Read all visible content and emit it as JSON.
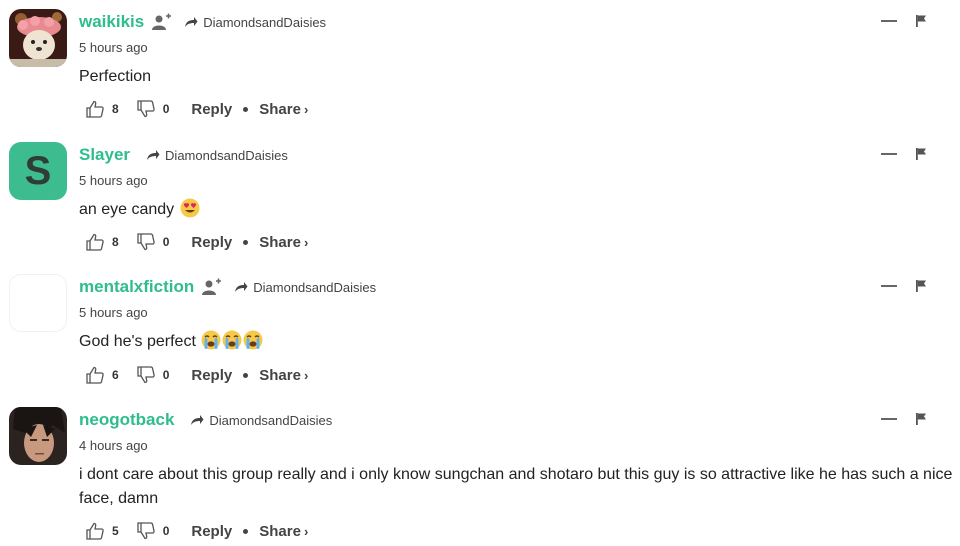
{
  "comments": [
    {
      "username": "waikikis",
      "reply_to": "DiamondsandDaisies",
      "time": "5 hours ago",
      "text": "Perfection",
      "likes": "8",
      "dislikes": "0",
      "reply_label": "Reply",
      "share_label": "Share",
      "share_chevron": "›"
    },
    {
      "username": "Slayer",
      "avatar_letter": "S",
      "reply_to": "DiamondsandDaisies",
      "time": "5 hours ago",
      "text": "an eye candy",
      "likes": "8",
      "dislikes": "0",
      "reply_label": "Reply",
      "share_label": "Share",
      "share_chevron": "›"
    },
    {
      "username": "mentalxfiction",
      "reply_to": "DiamondsandDaisies",
      "time": "5 hours ago",
      "text": "God he's perfect",
      "likes": "6",
      "dislikes": "0",
      "reply_label": "Reply",
      "share_label": "Share",
      "share_chevron": "›"
    },
    {
      "username": "neogotback",
      "reply_to": "DiamondsandDaisies",
      "time": "4 hours ago",
      "text": "i dont care about this group really and i only know sungchan and shotaro but this guy is so attractive like he has such a nice face, damn",
      "likes": "5",
      "dislikes": "0",
      "reply_label": "Reply",
      "share_label": "Share",
      "share_chevron": "›"
    }
  ],
  "colors": {
    "username": "#2ebd8b",
    "avatar_slayer": "#3dbd8f",
    "text": "#222222",
    "muted": "#444444"
  },
  "icons": {
    "follow": "user-plus-icon",
    "reply_to": "reply-arrow-icon",
    "collapse": "minus-icon",
    "report": "flag-icon",
    "like": "thumbs-up-icon",
    "dislike": "thumbs-down-icon",
    "emoji_heart_eyes": "heart-eyes-emoji",
    "emoji_crying": "loudly-crying-emoji"
  }
}
